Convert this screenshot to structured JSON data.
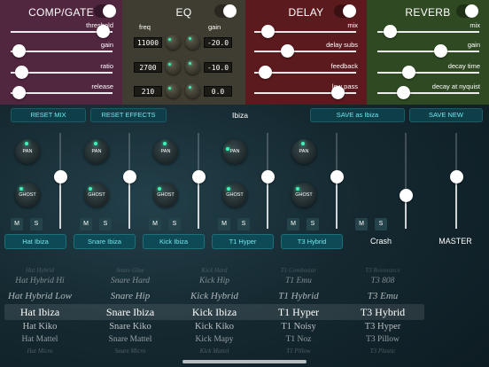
{
  "panels": {
    "comp": {
      "title": "COMP/GATE",
      "color": "#51263f",
      "params": [
        {
          "label": "threshold",
          "value": 0.9
        },
        {
          "label": "gain",
          "value": 0.08
        },
        {
          "label": "ratio",
          "value": 0.1
        },
        {
          "label": "release",
          "value": 0.08
        }
      ]
    },
    "eq": {
      "title": "EQ",
      "color": "#3f3d31",
      "freq_label": "freq",
      "gain_label": "gain",
      "bands": [
        {
          "freq": "11000",
          "gain": "-20.0"
        },
        {
          "freq": "2700",
          "gain": "-10.0"
        },
        {
          "freq": "210",
          "gain": "0.0"
        }
      ]
    },
    "delay": {
      "title": "DELAY",
      "color": "#5b1a1e",
      "params": [
        {
          "label": "mix",
          "value": 0.13
        },
        {
          "label": "delay subs",
          "value": 0.32
        },
        {
          "label": "feedback",
          "value": 0.1
        },
        {
          "label": "low pass",
          "value": 0.82
        }
      ]
    },
    "reverb": {
      "title": "REVERB",
      "color": "#2f4a22",
      "params": [
        {
          "label": "mix",
          "value": 0.12
        },
        {
          "label": "gain",
          "value": 0.62
        },
        {
          "label": "decay time",
          "value": 0.3
        },
        {
          "label": "decay at nyquist",
          "value": 0.25
        }
      ]
    }
  },
  "toolbar": {
    "reset_mix": "RESET MIX",
    "reset_effects": "RESET EFFECTS",
    "preset_name": "Ibiza",
    "save_as": "SAVE as Ibiza",
    "save_new": "SAVE NEW"
  },
  "mixer": {
    "pan_label": "PAN",
    "ghost_label": "GHOST",
    "mute_label": "M",
    "solo_label": "S",
    "channels": [
      {
        "name": "Hat Ibiza",
        "level": 0.55
      },
      {
        "name": "Snare Ibiza",
        "level": 0.55
      },
      {
        "name": "Kick Ibiza",
        "level": 0.55
      },
      {
        "name": "T1 Hyper",
        "level": 0.55
      },
      {
        "name": "T3 Hybrid",
        "level": 0.55
      },
      {
        "name": "Crash",
        "level": 0.35
      },
      {
        "name": "MASTER",
        "level": 0.55
      }
    ]
  },
  "wheels": [
    {
      "items": [
        "Hat Hybrid",
        "Hat Hybrid Hi",
        "Hat Hybrid Low",
        "Hat Ibiza",
        "Hat Kiko",
        "Hat Mattel",
        "Hat Micro"
      ]
    },
    {
      "items": [
        "Snare Glue",
        "Snare Hard",
        "Snare Hip",
        "Snare Ibiza",
        "Snare Kiko",
        "Snare Mattel",
        "Snare Micro"
      ]
    },
    {
      "items": [
        "Kick Hard",
        "Kick Hip",
        "Kick Hybrid",
        "Kick Ibiza",
        "Kick Kiko",
        "Kick Mapy",
        "Kick Mattel"
      ]
    },
    {
      "items": [
        "T1 Combostar",
        "T1 Emu",
        "T1 Hybrid",
        "T1 Hyper",
        "T1 Noisy",
        "T1 Noz",
        "T1 Pillow"
      ]
    },
    {
      "items": [
        "T3 Resonance",
        "T3 808",
        "T3 Emu",
        "T3 Hybrid",
        "T3 Hyper",
        "T3 Pillow",
        "T3 Plastic"
      ]
    }
  ]
}
